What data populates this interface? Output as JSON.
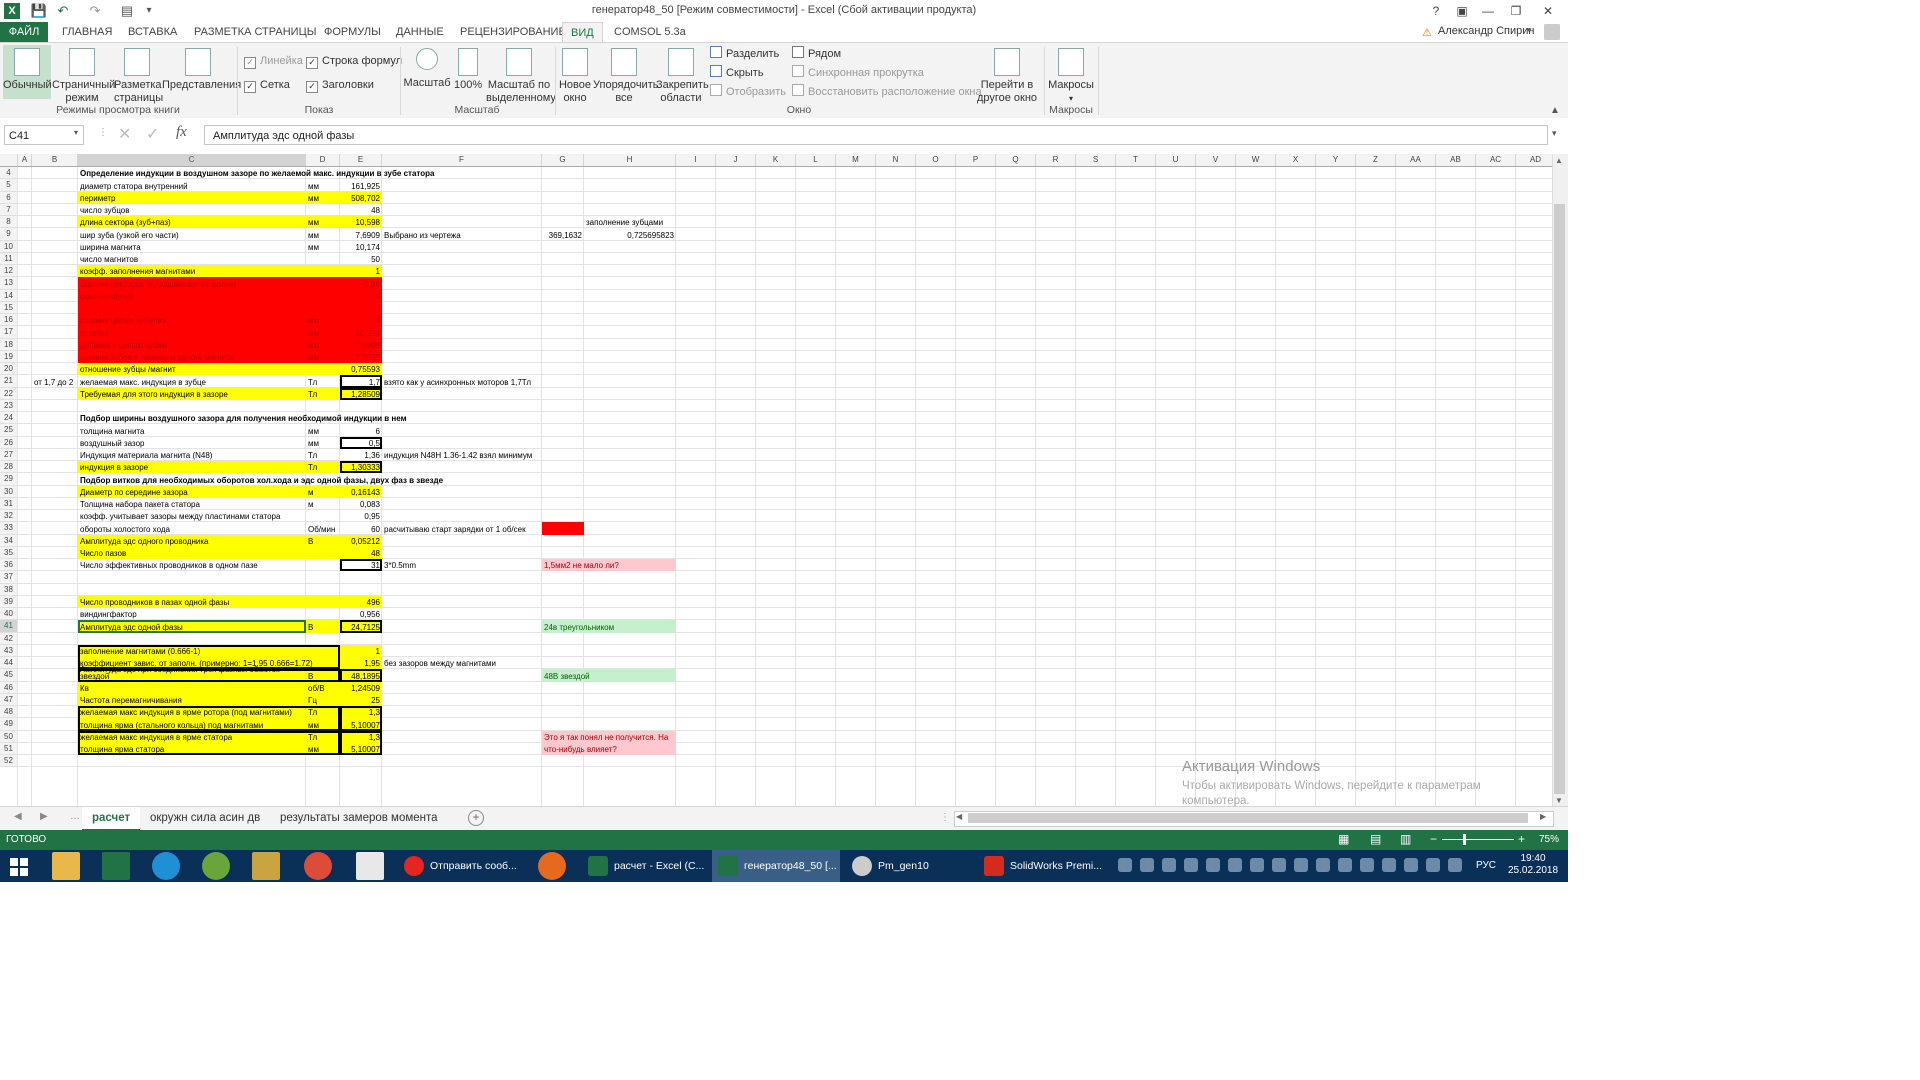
{
  "window": {
    "title": "генератор48_50  [Режим совместимости] - Excel (Сбой активации продукта)",
    "user": "Александр Спирин",
    "help": "?",
    "minimize": "—",
    "maximize": "❐",
    "close": "✕"
  },
  "tabs": [
    "ФАЙЛ",
    "ГЛАВНАЯ",
    "ВСТАВКА",
    "РАЗМЕТКА СТРАНИЦЫ",
    "ФОРМУЛЫ",
    "ДАННЫЕ",
    "РЕЦЕНЗИРОВАНИЕ",
    "ВИД",
    "COMSOL 5.3a"
  ],
  "ribbon": {
    "views": {
      "normal": "Обычный",
      "page1": "Страничный",
      "page2": "режим",
      "layout1": "Разметка",
      "layout2": "страницы",
      "custom": "Представления",
      "group": "Режимы просмотра книги"
    },
    "show": {
      "ruler": "Линейка",
      "formula_bar": "Строка формул",
      "gridlines": "Сетка",
      "headings": "Заголовки",
      "group": "Показ"
    },
    "zoom": {
      "zoom": "Масштаб",
      "hundred": "100%",
      "sel1": "Масштаб по",
      "sel2": "выделенному",
      "group": "Масштаб"
    },
    "window": {
      "new1": "Новое",
      "new2": "окно",
      "arrange1": "Упорядочить",
      "arrange2": "все",
      "freeze1": "Закрепить",
      "freeze2": "области",
      "split": "Разделить",
      "hide": "Скрыть",
      "unhide": "Отобразить",
      "side": "Рядом",
      "sync": "Синхронная прокрутка",
      "reset": "Восстановить расположение окна",
      "switch1": "Перейти в",
      "switch2": "другое окно",
      "group": "Окно"
    },
    "macros": {
      "label": "Макросы",
      "group": "Макросы"
    }
  },
  "formula_bar": {
    "cell_ref": "C41",
    "fx": "fx",
    "content": "Амплитуда эдс одной фазы"
  },
  "columns": [
    "A",
    "B",
    "C",
    "D",
    "E",
    "F",
    "G",
    "H",
    "I",
    "J",
    "K",
    "L",
    "M",
    "N",
    "O",
    "P",
    "Q",
    "R",
    "S",
    "T",
    "U",
    "V",
    "W",
    "X",
    "Y",
    "Z",
    "AA",
    "AB",
    "AC",
    "AD"
  ],
  "rows": [
    "4",
    "5",
    "6",
    "7",
    "8",
    "9",
    "10",
    "11",
    "12",
    "13",
    "14",
    "15",
    "16",
    "17",
    "18",
    "19",
    "20",
    "21",
    "22",
    "23",
    "24",
    "25",
    "26",
    "27",
    "28",
    "29",
    "30",
    "31",
    "32",
    "33",
    "34",
    "35",
    "36",
    "37",
    "38",
    "39",
    "40",
    "41",
    "42",
    "43",
    "44",
    "45",
    "46",
    "47",
    "48",
    "49",
    "50",
    "51",
    "52"
  ],
  "cells": {
    "r4c": "Определение индукции в воздушном зазоре по желаемой макс. индукции в зубе статора",
    "r5c": "диаметр статора внутренний",
    "r5d": "мм",
    "r5e": "161,925",
    "r6c": "периметр",
    "r6d": "мм",
    "r6e": "508,702",
    "r7c": "число зубцов",
    "r7e": "48",
    "r8c": "длина сектора (зуб+паз)",
    "r8d": "мм",
    "r8e": "10,598",
    "r8h": "заполнение зубцами",
    "r9c": "шир зуба (узкой его части)",
    "r9d": "мм",
    "r9e": "7,6909",
    "r9f": "Выбрано  из чертежа",
    "r9g": "369,1632",
    "r9h": "0,725695823",
    "r10c": "ширина магнита",
    "r10d": "мм",
    "r10e": "10,174",
    "r11c": "число магнитов",
    "r11e": "50",
    "r12c": "коэфф. заполнения магнитами",
    "r12e": "1",
    "r13c": "сколько секторов укладывается в1 магнит",
    "r13e": "0,96",
    "r14c": "сколько целых",
    "r14e": "0",
    "r16c": "ширина целых зуб+паз",
    "r16d": "мм",
    "r16e": "0",
    "r17c": "остаток",
    "r17d": "мм",
    "r17e": "10,174",
    "r18c": "добавка к целым зубам",
    "r18d": "мм",
    "r18e": "7,6909",
    "r19c": "ширина зубов в проекции одного магнита",
    "r19d": "мм",
    "r19e": "7,6909",
    "r20c": "отношение зубцы /магнит",
    "r20e": "0,75593",
    "r21b": "от 1,7 до 2",
    "r21c": "желаемая макс. индукция в зубце",
    "r21d": "Тл",
    "r21e": "1,7",
    "r21f": "взято как у асинхронных моторов 1,7Тл",
    "r22c": "Требуемая для этого индукция в зазоре",
    "r22d": "Тл",
    "r22e": "1,28509",
    "r24c": "Подбор ширины воздушного зазора для получения необходимой  индукции в нем",
    "r25c": "толщина магнита",
    "r25d": "мм",
    "r25e": "6",
    "r26c": "воздушный зазор",
    "r26d": "мм",
    "r26e": "0,5",
    "r27c": "Индукция материала магнита (N48)",
    "r27d": "Тл",
    "r27e": "1,36",
    "r27f": "индукция N48H 1.36-1.42 взял минимум",
    "r28c": "индукция в зазоре",
    "r28d": "Тл",
    "r28e": "1,30333",
    "r29c": "Подбор витков для необходимых оборотов хол.хода и эдс одной фазы, двух фаз в звезде",
    "r30c": "Диаметр по середине зазора",
    "r30d": "м",
    "r30e": "0,16143",
    "r31c": "Толщина набора пакета статора",
    "r31d": "м",
    "r31e": "0,083",
    "r32c": "коэфф. учитывает зазоры между пластинами статора",
    "r32e": "0,95",
    "r33c": "обороты холостого хода",
    "r33d": "Об/мин",
    "r33e": "60",
    "r33f": "расчитываю старт зарядки от 1 об/сек",
    "r34c": "Амплитуда эдс одного проводника",
    "r34d": "В",
    "r34e": "0,05212",
    "r35c": "Число пазов",
    "r35e": "48",
    "r36c": "Число эффективных проводников в одном пазе",
    "r36e": "31",
    "r36f": "3*0.5mm",
    "r36g": "1,5мм2 не мало ли?",
    "r39c": "Число проводников в пазах одной фазы",
    "r39e": "496",
    "r40c": "виндингфактор",
    "r40e": "0,956",
    "r41c": "Амплитуда эдс одной фазы",
    "r41d": "В",
    "r41e": "24,7125",
    "r41g": "24в треугольником",
    "r43c": "заполнение магнитами (0.666-1)",
    "r43e": "1",
    "r44c": "коэффициент завис. от заполн. (примерно: 1=1.95  0.666=1.72)",
    "r44e": "1,95",
    "r44f": "без зазоров между магнитами",
    "r45c1": "Амплитуда эдс при соединении трех фазных обмоток",
    "r45c2": "звездой",
    "r45d": "В",
    "r45e": "48,1895",
    "r45g": "48В звездой",
    "r46c": "Кв",
    "r46d": "об/В",
    "r46e": "1,24509",
    "r47c": "Частота перемагничивания",
    "r47d": "Гц",
    "r47e": "25",
    "r48c": "желаемая макс индукция в ярме ротора (под магнитами)",
    "r48d": "Тл",
    "r48e": "1,3",
    "r49c": "толщина ярма (стального кольца) под магнитами",
    "r49d": "мм",
    "r49e": "5,10007",
    "r50c": "желаемая макс индукция в ярме статора",
    "r50d": "Тл",
    "r50e": "1,3",
    "r50g1": "Это я так понял не получится. На",
    "r50g2": "что-нибудь влияет?",
    "r51c": "толщина ярма статора",
    "r51d": "мм",
    "r51e": "5,10007"
  },
  "colors": {
    "excel_green": "#217346",
    "yellow": "#ffff00",
    "red": "#ff0000",
    "pink": "#ffc7ce",
    "green_note": "#c6efce"
  },
  "sheets": [
    "расчет",
    "окружн сила асин дв",
    "результаты замеров момента"
  ],
  "status": {
    "ready": "ГОТОВО",
    "zoom": "75%"
  },
  "watermark": {
    "line1": "Активация Windows",
    "line2": "Чтобы активировать Windows, перейдите к параметрам",
    "line3": "компьютера."
  },
  "taskbar": {
    "tasks": [
      "Отправить сооб...",
      "расчет - Excel (С...",
      "генератор48_50  [...",
      "Pm_gen10",
      "SolidWorks Premi..."
    ],
    "lang": "РУС",
    "time": "19:40",
    "date": "25.02.2018"
  }
}
